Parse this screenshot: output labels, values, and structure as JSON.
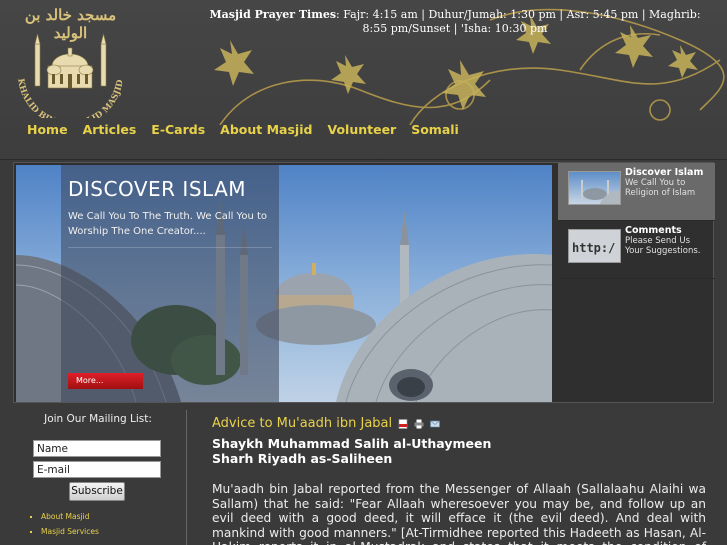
{
  "header": {
    "logo_arabic": "مسجد خالد بن الوليد",
    "logo_english": "KHALID BIN AL-WALID MASJID",
    "prayer_label": "Masjid Prayer Times",
    "prayer_times": ": Fajr: 4:15 am  |  Duhur/Jumah: 1:30 pm  |  Asr: 5:45 pm  |  Maghrib: 8:55 pm/Sunset  |  'Isha: 10:30 pm"
  },
  "nav": [
    {
      "label": "Home"
    },
    {
      "label": "Articles"
    },
    {
      "label": "E-Cards"
    },
    {
      "label": "About Masjid"
    },
    {
      "label": "Volunteer"
    },
    {
      "label": "Somali"
    }
  ],
  "slider": {
    "title": "DISCOVER ISLAM",
    "text": "We Call You To The Truth. We Call You to Worship The One Creator....",
    "more_label": "More...",
    "thumbs": [
      {
        "title": "Discover Islam",
        "subtitle": "We Call You to Religion of Islam"
      },
      {
        "title": "Comments",
        "subtitle": "Please Send Us Your Suggestions."
      }
    ]
  },
  "sidebar": {
    "mailing_title": "Join Our Mailing List:",
    "name_value": "Name",
    "email_value": "E-mail",
    "subscribe_label": "Subscribe",
    "links": [
      "About Masjid",
      "Masjid Services"
    ]
  },
  "article": {
    "title": "Advice to Mu'aadh ibn Jabal",
    "author": "Shaykh Muhammad Salih al-Uthaymeen",
    "book": "Sharh Riyadh as-Saliheen",
    "body": "Mu'aadh bin Jabal reported from the Messenger of Allaah (Sallalaahu Alaihi wa Sallam) that he said: \"Fear Allaah wheresoever you may be, and follow up an evil deed with a good deed, it will efface it (the evil deed). And deal with mankind with good manners.\" [At-Tirmidhee reported this Hadeeth as Hasan, Al-Hakim reports it in al-Mustadrak and states that it meets the condition of Bukhari and Muslim"
  },
  "colors": {
    "accent": "#e8d24a",
    "background": "#3a3a3a",
    "button": "#c01818"
  }
}
